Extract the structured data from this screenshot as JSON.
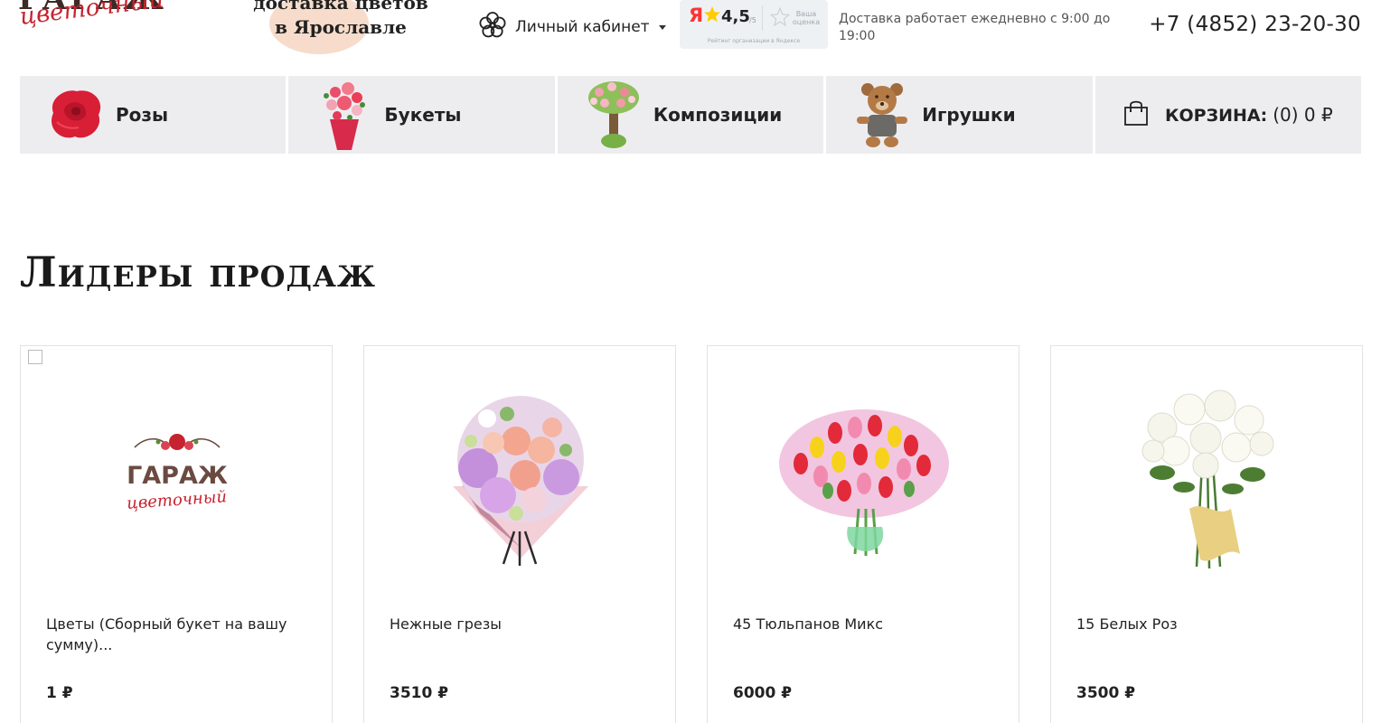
{
  "header": {
    "logo_top": "ГАРАЖ",
    "logo_script": "цветочный",
    "slogan_line1": "доставка цветов",
    "slogan_line2": "в Ярославле",
    "cabinet_label": "Личный кабинет",
    "yandex": {
      "logo": "Я",
      "score": "4,5",
      "of": "/5",
      "your_rating": "Ваша оценка",
      "caption": "Рейтинг организации в Яндексе"
    },
    "delivery_hours": "Доставка работает ежедневно с 9:00 до 19:00",
    "phone": "+7 (4852) 23-20-30"
  },
  "nav": {
    "items": [
      {
        "label": "Розы",
        "icon": "rose-icon"
      },
      {
        "label": "Букеты",
        "icon": "bouquet-icon"
      },
      {
        "label": "Композиции",
        "icon": "composition-tree-icon"
      },
      {
        "label": "Игрушки",
        "icon": "teddy-bear-icon"
      }
    ],
    "cart": {
      "label": "КОРЗИНА:",
      "value": "(0) 0 ₽",
      "icon": "shopping-bag-icon"
    }
  },
  "section_title": "Лидеры продаж",
  "products": [
    {
      "name": "Цветы (Сборный букет на вашу сумму)...",
      "price": "1 ₽",
      "image": "garage-logo-placeholder",
      "logo_top": "ГАРАЖ",
      "logo_script": "цветочный"
    },
    {
      "name": "Нежные грезы",
      "price": "3510 ₽",
      "image": "mixed-bouquet-pink-violet"
    },
    {
      "name": "45 Тюльпанов Микс",
      "price": "6000 ₽",
      "image": "tulip-bouquet-mix"
    },
    {
      "name": "15 Белых Роз",
      "price": "3500 ₽",
      "image": "white-roses-bouquet"
    }
  ],
  "colors": {
    "nav_bg": "#ededf0",
    "brand_red": "#c5232f",
    "brand_brown": "#3d2a26",
    "text": "#222222"
  }
}
